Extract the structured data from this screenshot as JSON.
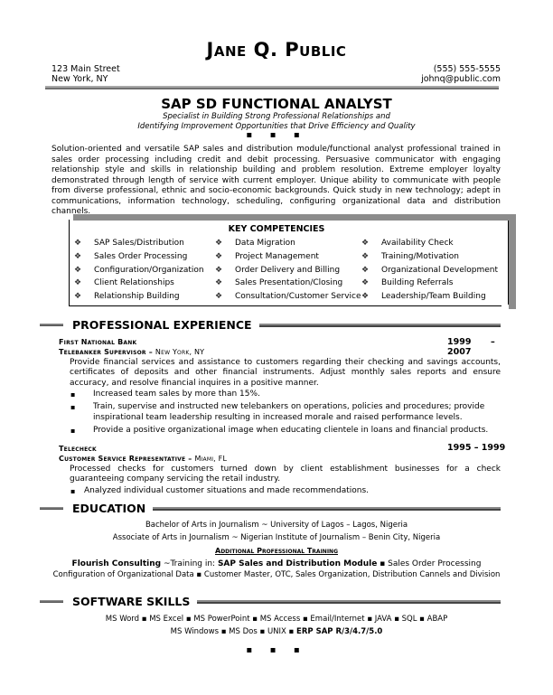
{
  "header": {
    "name_first_initial": "J",
    "name_first_rest": "ANE",
    "name_middle": "Q.",
    "name_last_initial": "P",
    "name_last_rest": "UBLIC",
    "address_line1": "123 Main Street",
    "address_line2": "New York, NY",
    "phone": "(555) 555-5555",
    "email": "johnq@public.com"
  },
  "title": "SAP SD FUNCTIONAL ANALYST",
  "tagline_line1": "Specialist in Building Strong Professional Relationships and",
  "tagline_line2": "Identifying Improvement Opportunities that Drive Efficiency and Quality",
  "divider_dots": "▪ ▪ ▪",
  "summary": "Solution-oriented and versatile SAP sales and distribution module/functional analyst professional trained in sales order processing including credit and debit processing. Persuasive communicator with engaging relationship style and skills in relationship building and problem resolution. Extreme employer loyalty demonstrated through length of service with current employer. Unique ability to communicate with people from diverse professional, ethnic and socio-economic backgrounds. Quick study in new technology; adept in communications, information technology, scheduling, configuring organizational data and distribution channels.",
  "competencies": {
    "title": "KEY COMPETENCIES",
    "bullet_icon": "❖",
    "columns": [
      [
        "SAP Sales/Distribution",
        "Sales Order Processing",
        "Configuration/Organization",
        "Client Relationships",
        "Relationship Building"
      ],
      [
        "Data Migration",
        "Project Management",
        "Order Delivery and Billing",
        "Sales Presentation/Closing",
        "Consultation/Customer Service"
      ],
      [
        "Availability Check",
        "Training/Motivation",
        "Organizational Development",
        "Building Referrals",
        "Leadership/Team Building"
      ]
    ]
  },
  "experience": {
    "heading": "PROFESSIONAL EXPERIENCE",
    "jobs": [
      {
        "company": "First National Bank",
        "role": "Telebanker Supervisor",
        "location": "New York, NY",
        "year_start": "1999",
        "dash": "–",
        "year_end": "2007",
        "description": "Provide financial services and assistance to customers regarding their checking and savings accounts, certificates of deposits and other financial instruments. Adjust monthly sales reports and ensure accuracy, and resolve financial inquires in a positive manner.",
        "bullets": [
          "Increased team sales by more than 15%.",
          "Train, supervise and instructed new telebankers on operations, policies and procedures; provide inspirational team leadership resulting in increased morale and raised performance levels.",
          "Provide a positive organizational image when educating clientele in loans and financial products."
        ]
      },
      {
        "company": "Telecheck",
        "role": "Customer Service Representative",
        "location": "Miami, FL",
        "years": "1995 – 1999",
        "description": "Processed checks for customers turned down by client establishment businesses for a check guaranteeing company servicing the retail industry.",
        "bullets": [
          "Analyzed individual customer situations and made recommendations."
        ]
      }
    ]
  },
  "education": {
    "heading": "EDUCATION",
    "degrees": [
      "Bachelor of Arts  in Journalism ~ University of Lagos – Lagos, Nigeria",
      "Associate of Arts  in Journalism ~ Nigerian Institute of Journalism – Benin City, Nigeria"
    ],
    "additional_heading": "Additional Professional Training",
    "training_org": "Flourish Consulting",
    "training_prefix": " ~Training in:  ",
    "training_bold": "SAP Sales and Distribution Module",
    "training_rest1": "  ▪  Sales Order Processing",
    "training_line2": "Configuration of Organizational Data  ▪  Customer Master, OTC, Sales Organization, Distribution Cannels and Division"
  },
  "software": {
    "heading": "SOFTWARE SKILLS",
    "line1": "MS Word ▪ MS Excel ▪ MS PowerPoint ▪ MS Access ▪ Email/Internet ▪ JAVA ▪ SQL ▪ ABAP",
    "line2_plain": "MS Windows ▪ MS Dos ▪ UNIX  ▪  ",
    "line2_bold": "ERP SAP R/3/4.7/5.0"
  }
}
